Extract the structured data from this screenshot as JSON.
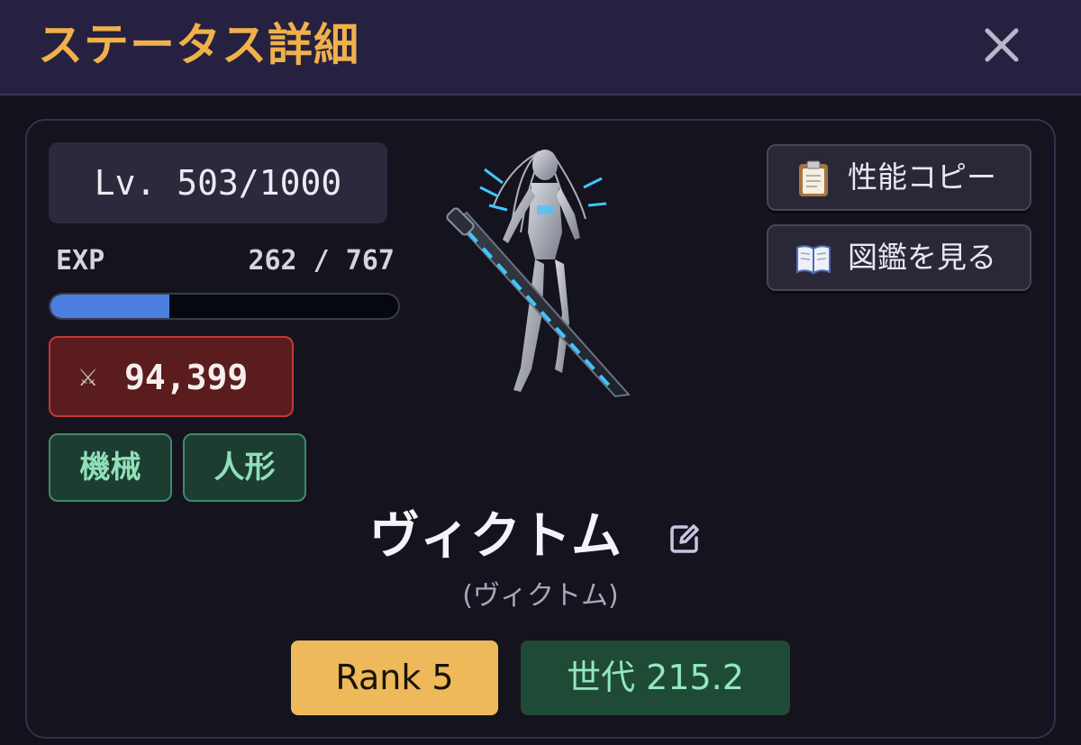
{
  "header": {
    "title": "ステータス詳細",
    "close_icon": "close-icon"
  },
  "status": {
    "level_text": "Lv. 503/1000",
    "exp_label": "EXP",
    "exp_value": "262 / 767",
    "exp_current": 262,
    "exp_max": 767,
    "exp_bar_color": "#4a7fe0",
    "power_icon": "crossed-swords-icon",
    "power_value": "94,399",
    "tags": [
      "機械",
      "人形"
    ]
  },
  "actions": {
    "copy_label": "性能コピー",
    "copy_icon": "clipboard-icon",
    "dex_label": "図鑑を見る",
    "dex_icon": "book-icon"
  },
  "character": {
    "name": "ヴィクトム",
    "reading": "(ヴィクトム)",
    "edit_icon": "edit-icon",
    "rank": "Rank 5",
    "generation": "世代 215.2"
  },
  "colors": {
    "accent_title": "#f0b04a",
    "power_bg": "#5a1c1c",
    "power_border": "#c43838",
    "tag_text": "#8fe0b8",
    "rank_bg": "#edb95a",
    "generation_bg": "#1f4a36"
  }
}
